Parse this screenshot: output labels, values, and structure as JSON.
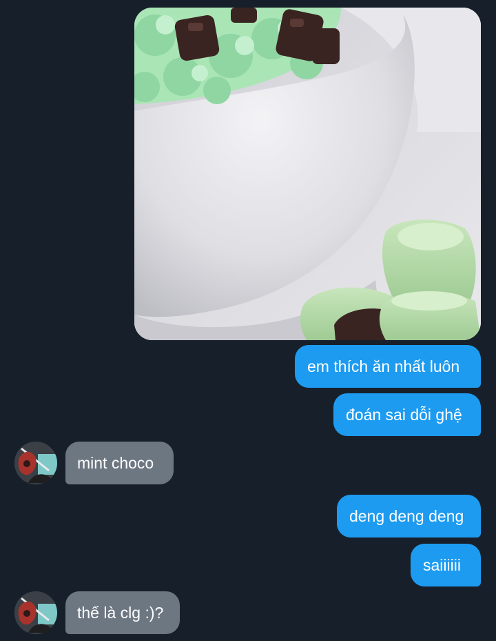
{
  "conversation": {
    "image": {
      "icon": "mint-chocolate-ice-cream-photo",
      "colors": {
        "bowl": "#e4e4e8",
        "mint": "#8fd6a2",
        "chocolate": "#3a2422",
        "candy": "#b9dcae"
      }
    },
    "messages": [
      {
        "from": "me",
        "text": "em thích ăn nhất luôn"
      },
      {
        "from": "me",
        "text": "đoán sai dỗi ghệ"
      },
      {
        "from": "other",
        "text": "mint choco"
      },
      {
        "from": "me",
        "text": "deng deng deng"
      },
      {
        "from": "me",
        "text": "saiiiiii"
      },
      {
        "from": "other",
        "text": "thế là clg :)?"
      }
    ],
    "colors": {
      "background": "#17202a",
      "outgoing_bubble": "#1d9bf0",
      "incoming_bubble": "#6d7782",
      "text": "#ffffff"
    }
  }
}
